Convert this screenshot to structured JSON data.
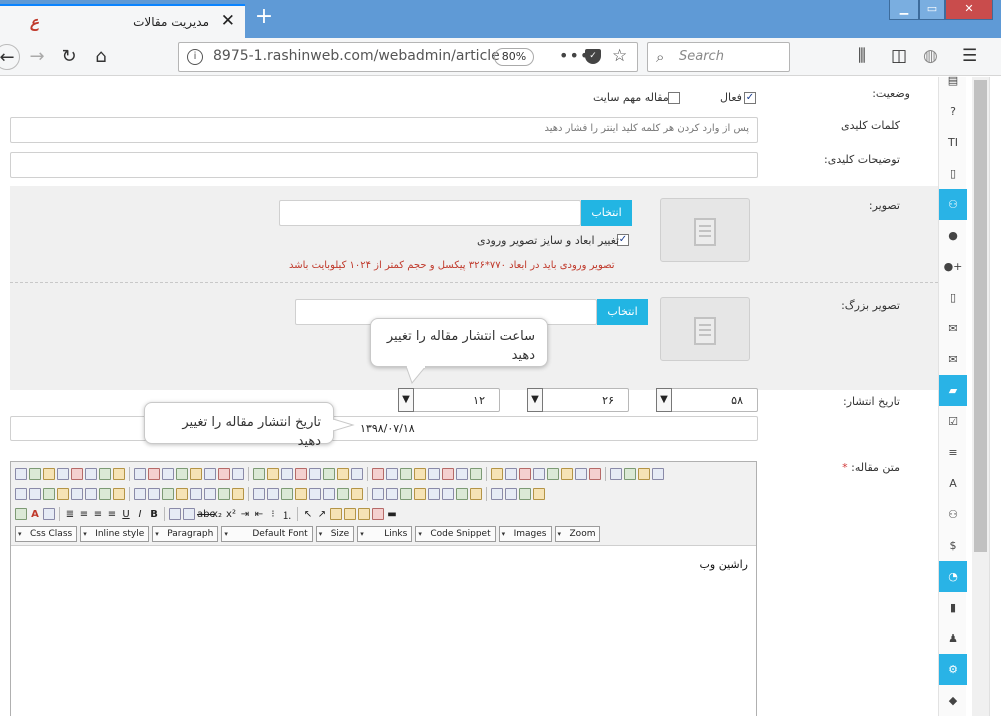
{
  "browser": {
    "tab_title": "مدیریت مقالات",
    "tab_icon": "ع",
    "url": "8975-1.rashinweb.com/webadmin/article",
    "zoom": "80%",
    "search_placeholder": "Search"
  },
  "form": {
    "status_label": "وضعیت:",
    "active_label": "فعال",
    "important_label": "مقاله مهم سایت",
    "keywords_label": "کلمات کلیدی",
    "keywords_placeholder": "پس از وارد کردن هر کلمه کلید اینتر را فشار دهید",
    "keyword_desc_label": "توضیحات کلیدی:",
    "image_label": "تصویر:",
    "choose_label": "انتخاب",
    "resize_label": "تغییر ابعاد و سایز تصویر ورودی",
    "image_warning": "تصویر ورودی باید در ابعاد ۷۷۰*۳۲۶ پیکسل و حجم کمتر از ۱۰۲۴ کیلوبایت باشد",
    "big_image_label": "تصویر بزرگ:",
    "publish_date_label": "تاریخ انتشار:",
    "minute_value": "۵۸",
    "hour_value": "۲۶",
    "second_value": "۱۲",
    "date_value": "۱۳۹۸/۰۷/۱۸",
    "article_text_label": "متن مقاله:",
    "required_mark": "*"
  },
  "tooltips": {
    "time_tip": "ساعت انتشار مقاله را تغییر دهید",
    "date_tip": "تاریخ انتشار مقاله را تغییر دهید"
  },
  "editor": {
    "combos": [
      "Css Class",
      "Inline style",
      "Paragraph",
      "Default Font",
      "Size",
      "Links",
      "Code Snippet",
      "Images",
      "Zoom"
    ],
    "content": "راشین وب"
  },
  "sidebar": {
    "icons": [
      "table-icon",
      "question-icon",
      "text-size-icon",
      "file-icon",
      "users-icon",
      "user-icon",
      "user-add-icon",
      "mobile-icon",
      "comments-icon",
      "envelope-icon",
      "folder-open-icon",
      "check-square-icon",
      "list-icon",
      "font-icon",
      "group-icon",
      "dollar-icon",
      "pie-chart-icon",
      "bar-chart-icon",
      "user-secret-icon",
      "gear-icon",
      "tags-icon"
    ],
    "active": [
      4,
      10,
      16,
      19
    ],
    "glyphs": [
      "▤",
      "?",
      "TI",
      "▯",
      "⚇",
      "●",
      "●+",
      "▯",
      "✉",
      "✉",
      "▰",
      "☑",
      "≡",
      "A",
      "⚇",
      "$",
      "◔",
      "▮",
      "♟",
      "⚙",
      "◆"
    ]
  }
}
